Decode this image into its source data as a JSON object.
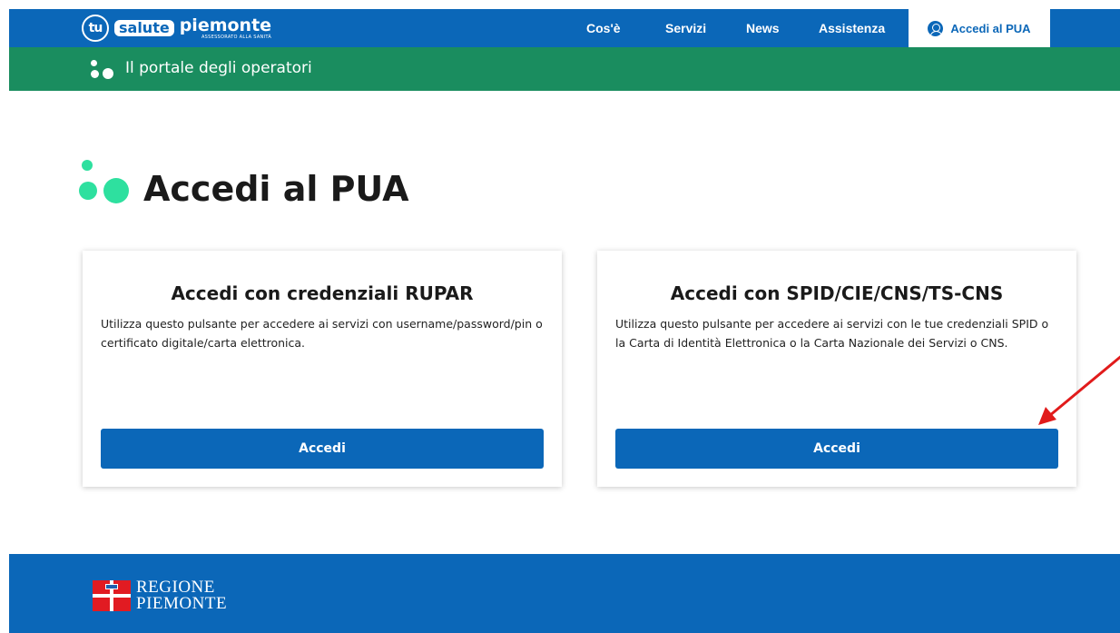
{
  "header": {
    "logo": {
      "tu": "tu",
      "salute": "salute",
      "piemonte": "piemonte",
      "subtitle": "ASSESSORATO ALLA SANITÀ"
    },
    "nav": [
      {
        "label": "Cos'è"
      },
      {
        "label": "Servizi"
      },
      {
        "label": "News"
      },
      {
        "label": "Assistenza"
      }
    ],
    "login_tab": {
      "label": "Accedi al PUA",
      "icon": "user-circle-icon"
    }
  },
  "subheader": {
    "title": "Il portale degli operatori"
  },
  "main": {
    "heading": "Accedi al PUA",
    "cards": [
      {
        "title": "Accedi con credenziali RUPAR",
        "text": "Utilizza questo pulsante per accedere ai servizi con username/password/pin o certificato digitale/carta elettronica.",
        "button": "Accedi"
      },
      {
        "title": "Accedi con SPID/CIE/CNS/TS-CNS",
        "text": "Utilizza questo pulsante per accedere ai servizi con le tue credenziali SPID o la Carta di Identità Elettronica o la Carta Nazionale dei Servizi o CNS.",
        "button": "Accedi"
      }
    ]
  },
  "footer": {
    "logo_line1": "REGIONE",
    "logo_line2": "PIEMONTE"
  },
  "colors": {
    "primary_blue": "#0b67b8",
    "green_bar": "#1a8d5f",
    "accent_green": "#2ee09f",
    "annotation_red": "#e11b1b"
  }
}
